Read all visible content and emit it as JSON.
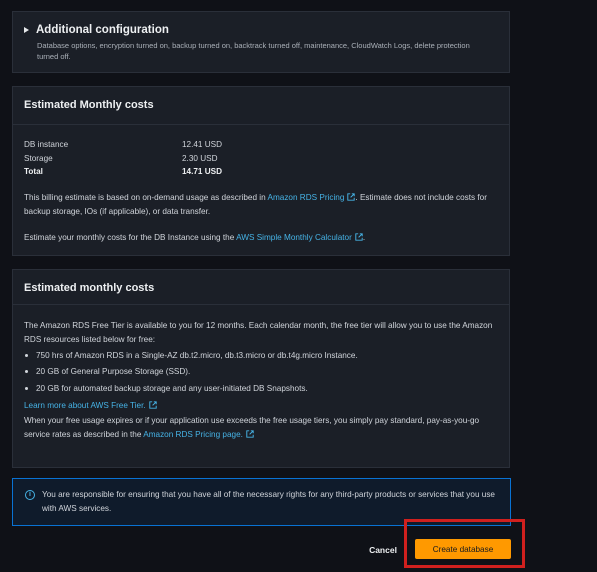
{
  "additional_config": {
    "title": "Additional configuration",
    "description": "Database options, encryption turned on, backup turned on, backtrack turned off, maintenance, CloudWatch Logs, delete protection turned off."
  },
  "monthly_costs": {
    "title": "Estimated Monthly costs",
    "rows": [
      {
        "label": "DB instance",
        "value": "12.41 USD"
      },
      {
        "label": "Storage",
        "value": "2.30 USD"
      },
      {
        "label": "Total",
        "value": "14.71 USD"
      }
    ],
    "billing_pre": "This billing estimate is based on on-demand usage as described in ",
    "billing_link": "Amazon RDS Pricing",
    "billing_post": ". Estimate does not include costs for backup storage, IOs (if applicable), or data transfer.",
    "estimate_pre": "Estimate your monthly costs for the DB Instance using the ",
    "estimate_link": "AWS Simple Monthly Calculator",
    "estimate_post": "."
  },
  "free_tier": {
    "title": "Estimated monthly costs",
    "intro": "The Amazon RDS Free Tier is available to you for 12 months. Each calendar month, the free tier will allow you to use the Amazon RDS resources listed below for free:",
    "items": [
      "750 hrs of Amazon RDS in a Single-AZ db.t2.micro, db.t3.micro or db.t4g.micro Instance.",
      "20 GB of General Purpose Storage (SSD).",
      "20 GB for automated backup storage and any user-initiated DB Snapshots."
    ],
    "learn_link": "Learn more about AWS Free Tier.",
    "after_pre": "When your free usage expires or if your application use exceeds the free usage tiers, you simply pay standard, pay-as-you-go service rates as described in the ",
    "after_link": "Amazon RDS Pricing page."
  },
  "alert": {
    "icon": "info-icon",
    "text": "You are responsible for ensuring that you have all of the necessary rights for any third-party products or services that you use with AWS services."
  },
  "actions": {
    "cancel": "Cancel",
    "create": "Create database"
  },
  "colors": {
    "accent": "#ff9900",
    "link": "#46b3e6",
    "highlight": "#d0201e"
  }
}
